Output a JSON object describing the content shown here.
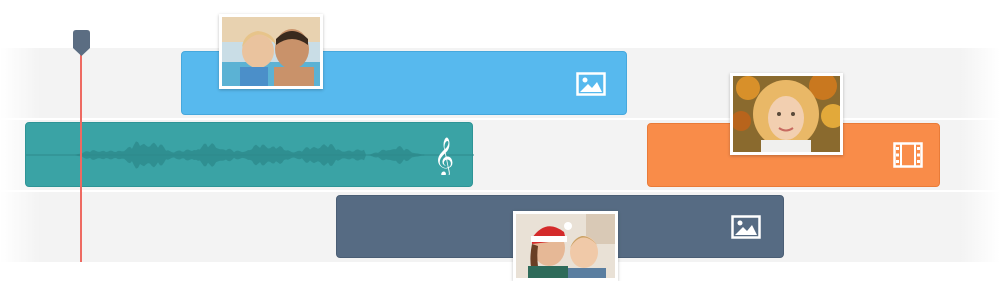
{
  "timeline": {
    "tracks": [
      "track-1",
      "track-2",
      "track-3"
    ],
    "clips": [
      {
        "id": "image-clip-1",
        "type": "image",
        "icon": "image-icon",
        "color": "#57b9ee",
        "thumbnail": "father-and-child-photo"
      },
      {
        "id": "audio-clip",
        "type": "audio",
        "icon": "treble-clef-icon",
        "color": "#3aa3a5"
      },
      {
        "id": "video-clip",
        "type": "video",
        "icon": "film-strip-icon",
        "color": "#f98c49",
        "thumbnail": "girl-with-autumn-leaves-photo"
      },
      {
        "id": "image-clip-2",
        "type": "image",
        "icon": "image-icon",
        "color": "#566b83",
        "thumbnail": "mother-and-child-santa-hat-photo"
      }
    ],
    "playhead": {
      "color": "#ee6a62",
      "handle_color": "#5b6d82"
    }
  }
}
